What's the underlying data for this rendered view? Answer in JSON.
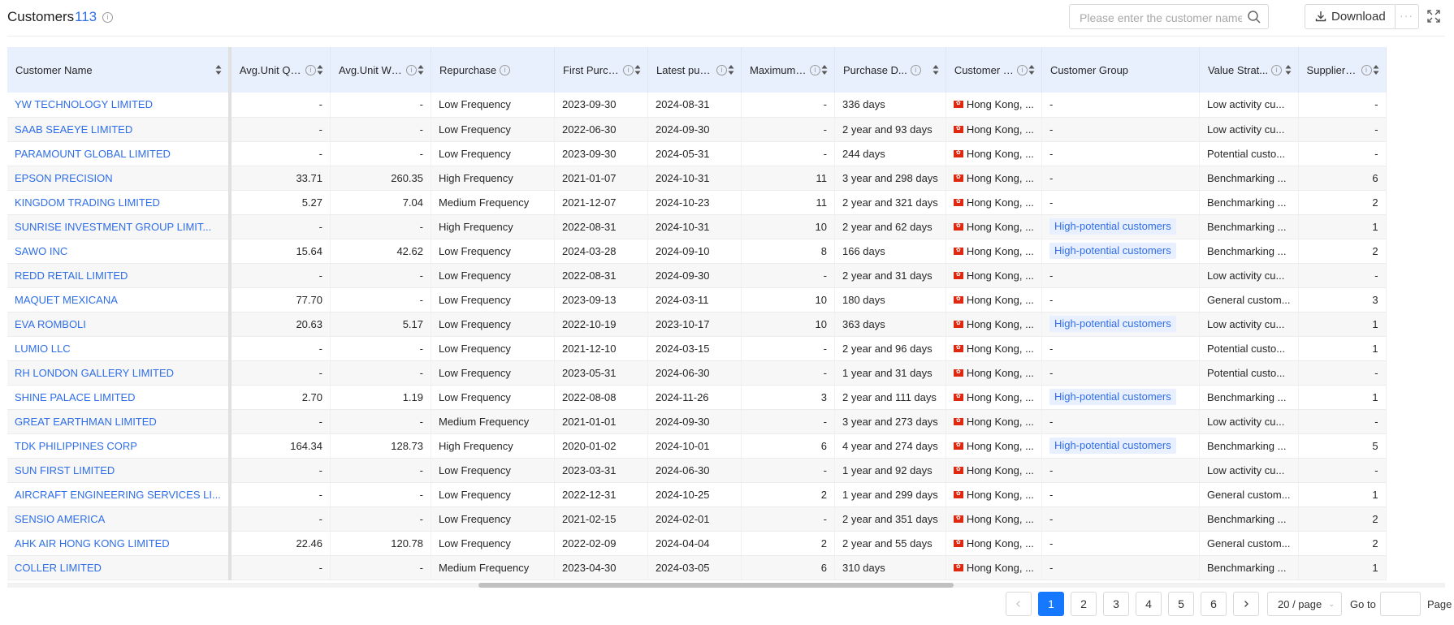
{
  "header": {
    "title": "Customers",
    "count": "113",
    "search_placeholder": "Please enter the customer name",
    "download_label": "Download",
    "more_label": "···"
  },
  "columns": [
    {
      "label": "Customer Name",
      "info": false
    },
    {
      "label": "Avg.Unit Qty P...",
      "info": true
    },
    {
      "label": "Avg.Unit Wgt ...",
      "info": true
    },
    {
      "label": "Repurchase",
      "info": true
    },
    {
      "label": "First Purcha...",
      "info": true
    },
    {
      "label": "Latest purc...",
      "info": true
    },
    {
      "label": "Maximum D...",
      "info": true
    },
    {
      "label": "Purchase D...",
      "info": true
    },
    {
      "label": "Customer L...",
      "info": true
    },
    {
      "label": "Customer Group",
      "info": false
    },
    {
      "label": "Value Strat...",
      "info": true
    },
    {
      "label": "Supplier L...",
      "info": true
    }
  ],
  "rows": [
    {
      "name": "YW TECHNOLOGY LIMITED",
      "qty": "-",
      "wgt": "-",
      "repurchase": "Low Frequency",
      "first": "2023-09-30",
      "latest": "2024-08-31",
      "max": "-",
      "duration": "336 days",
      "location": "Hong Kong, ...",
      "group": "-",
      "value": "Low activity cu...",
      "supplier": "-"
    },
    {
      "name": "SAAB SEAEYE LIMITED",
      "qty": "-",
      "wgt": "-",
      "repurchase": "Low Frequency",
      "first": "2022-06-30",
      "latest": "2024-09-30",
      "max": "-",
      "duration": "2 year and 93 days",
      "location": "Hong Kong, ...",
      "group": "-",
      "value": "Low activity cu...",
      "supplier": "-"
    },
    {
      "name": "PARAMOUNT GLOBAL LIMITED",
      "qty": "-",
      "wgt": "-",
      "repurchase": "Low Frequency",
      "first": "2023-09-30",
      "latest": "2024-05-31",
      "max": "-",
      "duration": "244 days",
      "location": "Hong Kong, ...",
      "group": "-",
      "value": "Potential custo...",
      "supplier": "-"
    },
    {
      "name": "EPSON PRECISION",
      "qty": "33.71",
      "wgt": "260.35",
      "repurchase": "High Frequency",
      "first": "2021-01-07",
      "latest": "2024-10-31",
      "max": "11",
      "duration": "3 year and 298 days",
      "location": "Hong Kong, ...",
      "group": "-",
      "value": "Benchmarking ...",
      "supplier": "6"
    },
    {
      "name": "KINGDOM TRADING LIMITED",
      "qty": "5.27",
      "wgt": "7.04",
      "repurchase": "Medium Frequency",
      "first": "2021-12-07",
      "latest": "2024-10-23",
      "max": "11",
      "duration": "2 year and 321 days",
      "location": "Hong Kong, ...",
      "group": "-",
      "value": "Benchmarking ...",
      "supplier": "2"
    },
    {
      "name": "SUNRISE INVESTMENT GROUP LIMIT...",
      "qty": "-",
      "wgt": "-",
      "repurchase": "High Frequency",
      "first": "2022-08-31",
      "latest": "2024-10-31",
      "max": "10",
      "duration": "2 year and 62 days",
      "location": "Hong Kong, ...",
      "group": "High-potential customers",
      "value": "Benchmarking ...",
      "supplier": "1"
    },
    {
      "name": "SAWO INC",
      "qty": "15.64",
      "wgt": "42.62",
      "repurchase": "Low Frequency",
      "first": "2024-03-28",
      "latest": "2024-09-10",
      "max": "8",
      "duration": "166 days",
      "location": "Hong Kong, ...",
      "group": "High-potential customers",
      "value": "Benchmarking ...",
      "supplier": "2"
    },
    {
      "name": "REDD RETAIL LIMITED",
      "qty": "-",
      "wgt": "-",
      "repurchase": "Low Frequency",
      "first": "2022-08-31",
      "latest": "2024-09-30",
      "max": "-",
      "duration": "2 year and 31 days",
      "location": "Hong Kong, ...",
      "group": "-",
      "value": "Low activity cu...",
      "supplier": "-"
    },
    {
      "name": "MAQUET MEXICANA",
      "qty": "77.70",
      "wgt": "-",
      "repurchase": "Low Frequency",
      "first": "2023-09-13",
      "latest": "2024-03-11",
      "max": "10",
      "duration": "180 days",
      "location": "Hong Kong, ...",
      "group": "-",
      "value": "General custom...",
      "supplier": "3"
    },
    {
      "name": "EVA ROMBOLI",
      "qty": "20.63",
      "wgt": "5.17",
      "repurchase": "Low Frequency",
      "first": "2022-10-19",
      "latest": "2023-10-17",
      "max": "10",
      "duration": "363 days",
      "location": "Hong Kong, ...",
      "group": "High-potential customers",
      "value": "Low activity cu...",
      "supplier": "1"
    },
    {
      "name": "LUMIO LLC",
      "qty": "-",
      "wgt": "-",
      "repurchase": "Low Frequency",
      "first": "2021-12-10",
      "latest": "2024-03-15",
      "max": "-",
      "duration": "2 year and 96 days",
      "location": "Hong Kong, ...",
      "group": "-",
      "value": "Potential custo...",
      "supplier": "1"
    },
    {
      "name": "RH LONDON GALLERY LIMITED",
      "qty": "-",
      "wgt": "-",
      "repurchase": "Low Frequency",
      "first": "2023-05-31",
      "latest": "2024-06-30",
      "max": "-",
      "duration": "1 year and 31 days",
      "location": "Hong Kong, ...",
      "group": "-",
      "value": "Potential custo...",
      "supplier": "-"
    },
    {
      "name": "SHINE PALACE LIMITED",
      "qty": "2.70",
      "wgt": "1.19",
      "repurchase": "Low Frequency",
      "first": "2022-08-08",
      "latest": "2024-11-26",
      "max": "3",
      "duration": "2 year and 111 days",
      "location": "Hong Kong, ...",
      "group": "High-potential customers",
      "value": "Benchmarking ...",
      "supplier": "1"
    },
    {
      "name": "GREAT EARTHMAN LIMITED",
      "qty": "-",
      "wgt": "-",
      "repurchase": "Medium Frequency",
      "first": "2021-01-01",
      "latest": "2024-09-30",
      "max": "-",
      "duration": "3 year and 273 days",
      "location": "Hong Kong, ...",
      "group": "-",
      "value": "Low activity cu...",
      "supplier": "-"
    },
    {
      "name": "TDK PHILIPPINES CORP",
      "qty": "164.34",
      "wgt": "128.73",
      "repurchase": "High Frequency",
      "first": "2020-01-02",
      "latest": "2024-10-01",
      "max": "6",
      "duration": "4 year and 274 days",
      "location": "Hong Kong, ...",
      "group": "High-potential customers",
      "value": "Benchmarking ...",
      "supplier": "5"
    },
    {
      "name": "SUN FIRST LIMITED",
      "qty": "-",
      "wgt": "-",
      "repurchase": "Low Frequency",
      "first": "2023-03-31",
      "latest": "2024-06-30",
      "max": "-",
      "duration": "1 year and 92 days",
      "location": "Hong Kong, ...",
      "group": "-",
      "value": "Low activity cu...",
      "supplier": "-"
    },
    {
      "name": "AIRCRAFT ENGINEERING SERVICES LI...",
      "qty": "-",
      "wgt": "-",
      "repurchase": "Low Frequency",
      "first": "2022-12-31",
      "latest": "2024-10-25",
      "max": "2",
      "duration": "1 year and 299 days",
      "location": "Hong Kong, ...",
      "group": "-",
      "value": "General custom...",
      "supplier": "1"
    },
    {
      "name": "SENSIO AMERICA",
      "qty": "-",
      "wgt": "-",
      "repurchase": "Low Frequency",
      "first": "2021-02-15",
      "latest": "2024-02-01",
      "max": "-",
      "duration": "2 year and 351 days",
      "location": "Hong Kong, ...",
      "group": "-",
      "value": "Benchmarking ...",
      "supplier": "2"
    },
    {
      "name": "AHK AIR HONG KONG LIMITED",
      "qty": "22.46",
      "wgt": "120.78",
      "repurchase": "Low Frequency",
      "first": "2022-02-09",
      "latest": "2024-04-04",
      "max": "2",
      "duration": "2 year and 55 days",
      "location": "Hong Kong, ...",
      "group": "-",
      "value": "General custom...",
      "supplier": "2"
    },
    {
      "name": "COLLER LIMITED",
      "qty": "-",
      "wgt": "-",
      "repurchase": "Medium Frequency",
      "first": "2023-04-30",
      "latest": "2024-03-05",
      "max": "6",
      "duration": "310 days",
      "location": "Hong Kong, ...",
      "group": "-",
      "value": "Benchmarking ...",
      "supplier": "1"
    }
  ],
  "pagination": {
    "pages": [
      "1",
      "2",
      "3",
      "4",
      "5",
      "6"
    ],
    "current": "1",
    "page_size": "20 / page",
    "goto_label": "Go to",
    "page_label": "Page"
  },
  "colors": {
    "accent": "#1677ff",
    "link": "#2f6ee8",
    "header_bg": "#e9f0fd",
    "flag": "#de2910",
    "tag_bg": "#e8efff"
  }
}
